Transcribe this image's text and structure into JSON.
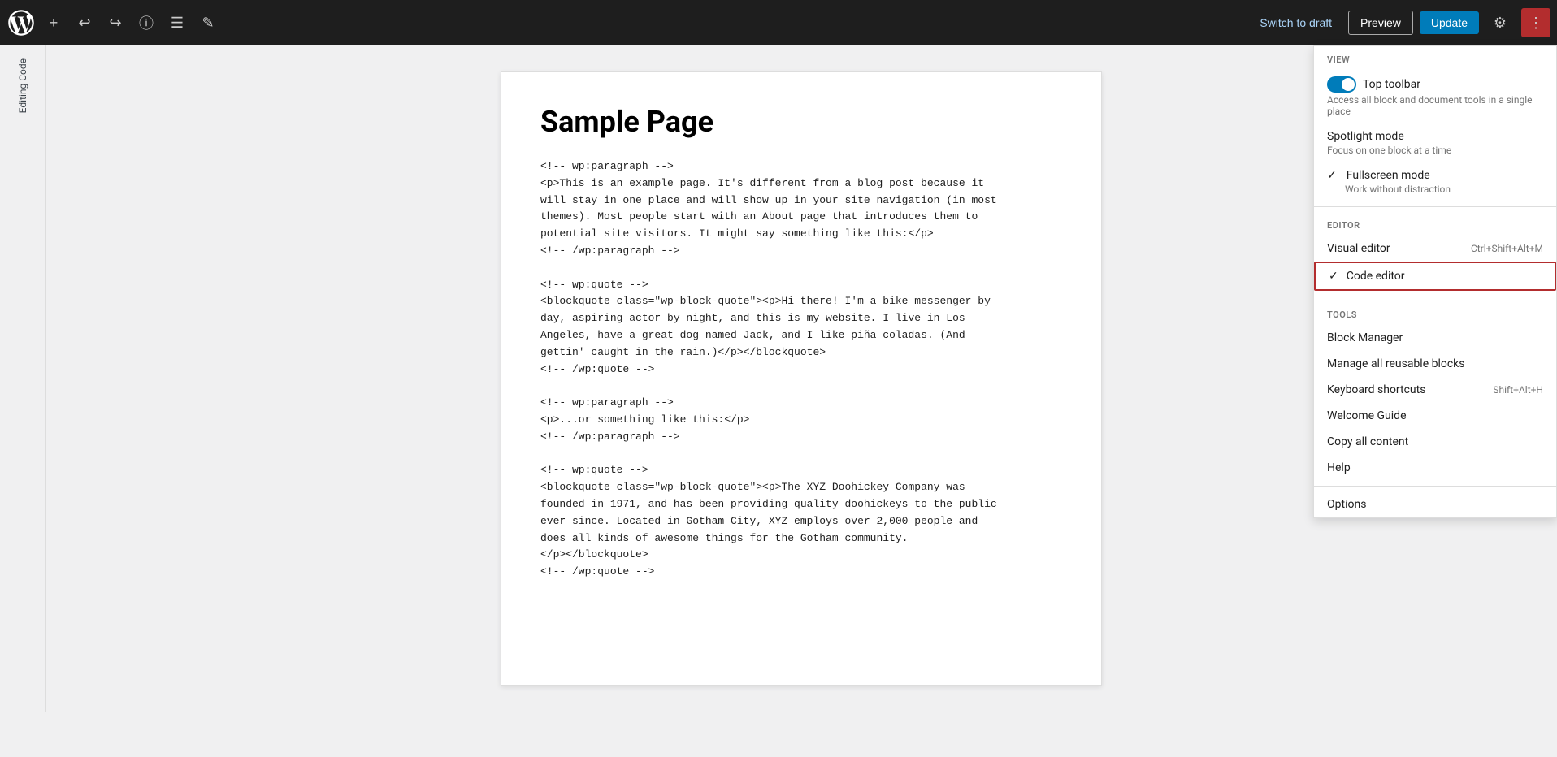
{
  "toolbar": {
    "wp_logo_label": "WordPress",
    "add_block_label": "+",
    "undo_label": "Undo",
    "redo_label": "Redo",
    "info_label": "Info",
    "list_view_label": "List View",
    "tools_label": "Tools",
    "switch_draft_label": "Switch to draft",
    "preview_label": "Preview",
    "update_label": "Update",
    "settings_label": "Settings",
    "more_label": "More"
  },
  "editing_code_label": "Editing Code",
  "page": {
    "title": "Sample Page",
    "code_content": "<!-- wp:paragraph -->\n<p>This is an example page. It's different from a blog post because it\nwill stay in one place and will show up in your site navigation (in most\nthemes). Most people start with an About page that introduces them to\npotential site visitors. It might say something like this:</p>\n<!-- /wp:paragraph -->\n\n<!-- wp:quote -->\n<blockquote class=\"wp-block-quote\"><p>Hi there! I'm a bike messenger by\nday, aspiring actor by night, and this is my website. I live in Los\nAngeles, have a great dog named Jack, and I like piña coladas. (And\ngettin' caught in the rain.)</p></blockquote>\n<!-- /wp:quote -->\n\n<!-- wp:paragraph -->\n<p>...or something like this:</p>\n<!-- /wp:paragraph -->\n\n<!-- wp:quote -->\n<blockquote class=\"wp-block-quote\"><p>The XYZ Doohickey Company was\nfounded in 1971, and has been providing quality doohickeys to the public\never since. Located in Gotham City, XYZ employs over 2,000 people and\ndoes all kinds of awesome things for the Gotham community.\n</p></blockquote>\n<!-- /wp:quote -->"
  },
  "dropdown": {
    "view_section": "View",
    "top_toolbar_title": "Top toolbar",
    "top_toolbar_desc": "Access all block and document tools in a single place",
    "spotlight_mode_title": "Spotlight mode",
    "spotlight_mode_desc": "Focus on one block at a time",
    "fullscreen_mode_title": "Fullscreen mode",
    "fullscreen_mode_desc": "Work without distraction",
    "editor_section": "Editor",
    "visual_editor_label": "Visual editor",
    "visual_editor_shortcut": "Ctrl+Shift+Alt+M",
    "code_editor_label": "Code editor",
    "tools_section": "Tools",
    "block_manager_label": "Block Manager",
    "manage_reusable_label": "Manage all reusable blocks",
    "keyboard_shortcuts_label": "Keyboard shortcuts",
    "keyboard_shortcuts_shortcut": "Shift+Alt+H",
    "welcome_guide_label": "Welcome Guide",
    "copy_all_label": "Copy all content",
    "help_label": "Help",
    "options_label": "Options"
  }
}
